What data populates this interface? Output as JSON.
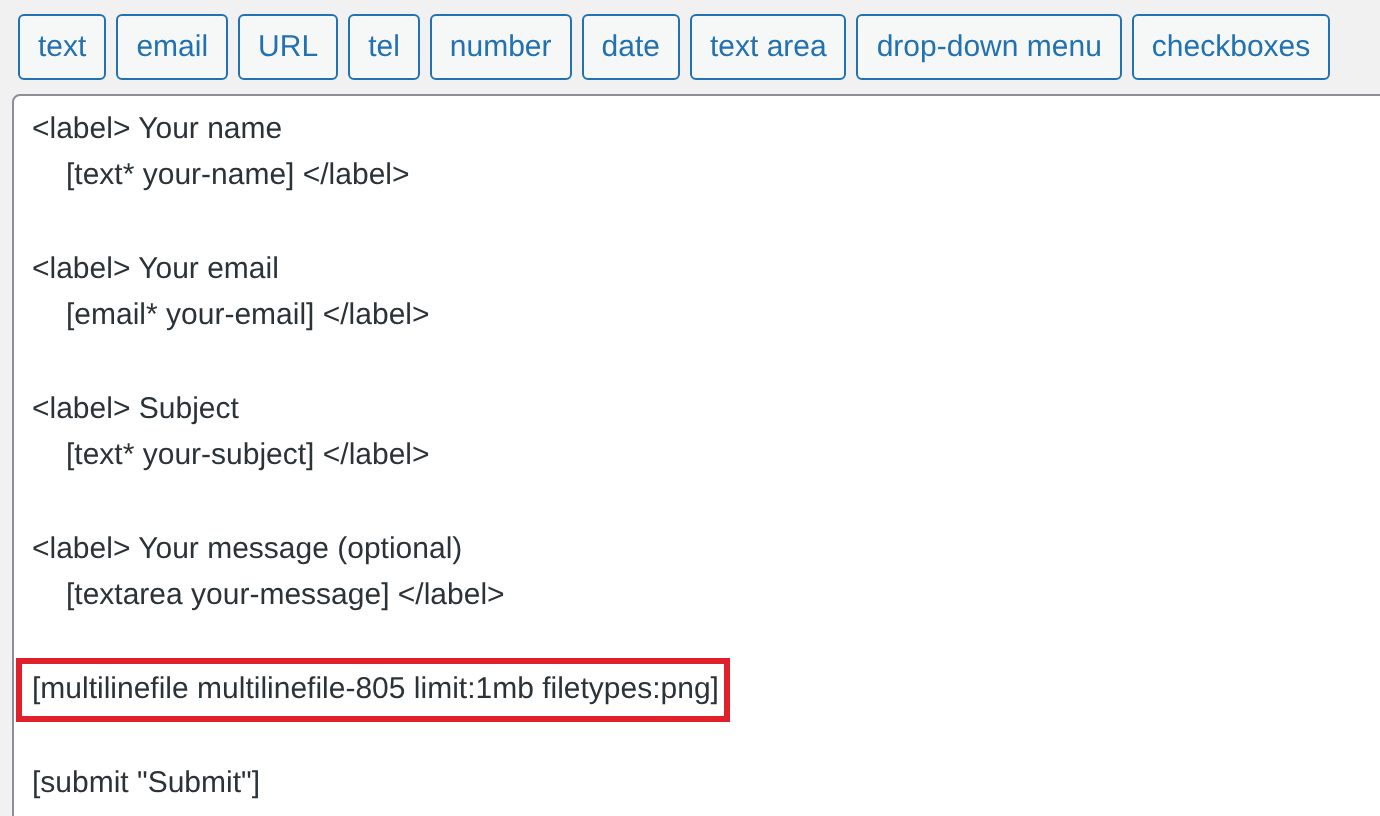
{
  "tag_buttons": [
    "text",
    "email",
    "URL",
    "tel",
    "number",
    "date",
    "text area",
    "drop-down menu",
    "checkboxes"
  ],
  "editor": {
    "blocks": [
      {
        "lines": [
          {
            "text": "<label> Your name",
            "indent": false,
            "highlighted": false
          },
          {
            "text": "[text* your-name] </label>",
            "indent": true,
            "highlighted": false
          }
        ]
      },
      {
        "lines": [
          {
            "text": "<label> Your email",
            "indent": false,
            "highlighted": false
          },
          {
            "text": "[email* your-email] </label>",
            "indent": true,
            "highlighted": false
          }
        ]
      },
      {
        "lines": [
          {
            "text": "<label> Subject",
            "indent": false,
            "highlighted": false
          },
          {
            "text": "[text* your-subject] </label>",
            "indent": true,
            "highlighted": false
          }
        ]
      },
      {
        "lines": [
          {
            "text": "<label> Your message (optional)",
            "indent": false,
            "highlighted": false
          },
          {
            "text": "[textarea your-message] </label>",
            "indent": true,
            "highlighted": false
          }
        ]
      },
      {
        "lines": [
          {
            "text": "[multilinefile multilinefile-805 limit:1mb filetypes:png]",
            "indent": false,
            "highlighted": true
          }
        ]
      },
      {
        "lines": [
          {
            "text": "[submit \"Submit\"]",
            "indent": false,
            "highlighted": false
          }
        ]
      }
    ]
  }
}
